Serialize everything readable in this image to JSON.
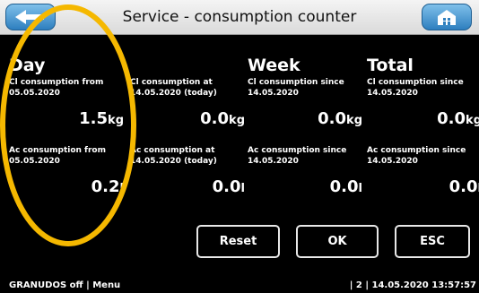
{
  "header": {
    "title": "Service - consumption counter",
    "back_icon": "arrow-left-icon",
    "home_icon": "home-icon",
    "accent": "#3a8fd0"
  },
  "columns": [
    {
      "heading": "Day",
      "cl_label": "Cl consumption from 05.05.2020",
      "cl_value": "1.5",
      "cl_unit": "kg",
      "ac_label": "Ac consumption from 05.05.2020",
      "ac_value": "0.2",
      "ac_unit": "l"
    },
    {
      "heading": "",
      "cl_label": "Cl consumption at 14.05.2020 (today)",
      "cl_value": "0.0",
      "cl_unit": "kg",
      "ac_label": "Ac consumption at 14.05.2020 (today)",
      "ac_value": "0.0",
      "ac_unit": "l"
    },
    {
      "heading": "Week",
      "cl_label": "Cl consumption since 14.05.2020",
      "cl_value": "0.0",
      "cl_unit": "kg",
      "ac_label": "Ac consumption since 14.05.2020",
      "ac_value": "0.0",
      "ac_unit": "l"
    },
    {
      "heading": "Total",
      "cl_label": "Cl consumption since 14.05.2020",
      "cl_value": "0.0",
      "cl_unit": "kg",
      "ac_label": "Ac consumption since 14.05.2020",
      "ac_value": "0.0",
      "ac_unit": "l"
    }
  ],
  "buttons": {
    "reset": "Reset",
    "ok": "OK",
    "esc": "ESC"
  },
  "status": {
    "left": "GRANUDOS off | Menu",
    "right": "| 2 | 14.05.2020 13:57:57"
  },
  "annotation": {
    "color": "#f5b800"
  }
}
